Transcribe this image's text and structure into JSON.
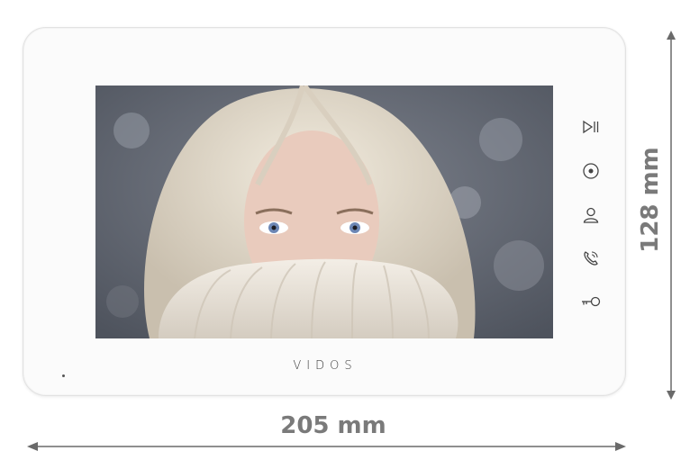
{
  "device": {
    "brand": "VIDOS",
    "buttons": [
      {
        "icon": "play-pause-icon"
      },
      {
        "icon": "monitor-icon"
      },
      {
        "icon": "user-icon"
      },
      {
        "icon": "phone-icon"
      },
      {
        "icon": "key-icon"
      }
    ],
    "screen_content": "photo"
  },
  "dimensions": {
    "width": "205 mm",
    "height": "128 mm"
  },
  "colors": {
    "dimension_text": "#7a7a7a",
    "arrow": "#6a6a6a",
    "device_body": "#fbfbfb"
  }
}
